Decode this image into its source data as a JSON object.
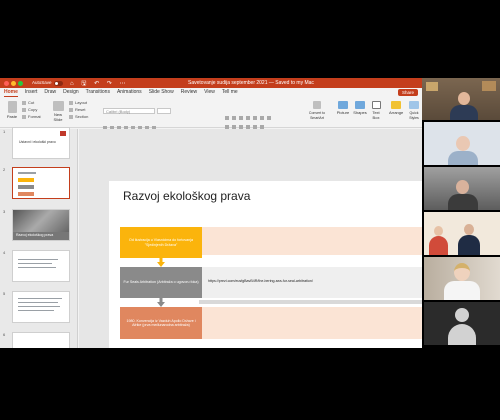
{
  "window": {
    "autosave_label": "AutoSave",
    "autosave_state": "Off",
    "title": "Savetovanje sudija september 2021 — Saved to my Mac"
  },
  "ribbon": {
    "tabs": [
      "Home",
      "Insert",
      "Draw",
      "Design",
      "Transitions",
      "Animations",
      "Slide Show",
      "Review",
      "View",
      "Tell me"
    ],
    "active_tab": "Home",
    "share_label": "Share",
    "paste_label": "Paste",
    "cut_label": "Cut",
    "copy_label": "Copy",
    "format_label": "Format",
    "new_slide_label": "New Slide",
    "layout_label": "Layout",
    "reset_label": "Reset",
    "section_label": "Section",
    "font_name": "Calibri (Body)",
    "convert_label": "Convert to SmartArt",
    "picture_label": "Picture",
    "shapes_label": "Shapes",
    "textbox_label": "Text Box",
    "arrange_label": "Arrange",
    "quick_styles_label": "Quick Styles"
  },
  "thumbnails": {
    "numbers": [
      "1",
      "2",
      "3",
      "4",
      "5",
      "6"
    ],
    "slide1_title": "Ustavni i ekološki pravo",
    "slide3_caption": "Razvoj ekološkog prava"
  },
  "slide": {
    "title": "Razvoj ekološkog prava",
    "box1": "Od ilustracija u Vlasnicima do fortovanja \"Sjedinjenih Država\"",
    "box2": "Fur Seals Arbitration (Arbitraža o ugovoru foka)",
    "box3": "1980. Konvencija iz Vazduh Apollo Države i Afrike (prva međunarodna arbitraža)",
    "link": "https://prezi.com/eusfgBavB4R/the-bering-sea-fur-seal-arbitration/"
  },
  "colors": {
    "accent": "#c43e1c",
    "box1": "#fbb40c",
    "box2": "#8a8a8a",
    "box3": "#e0875f",
    "peach": "#fbe4d5"
  }
}
